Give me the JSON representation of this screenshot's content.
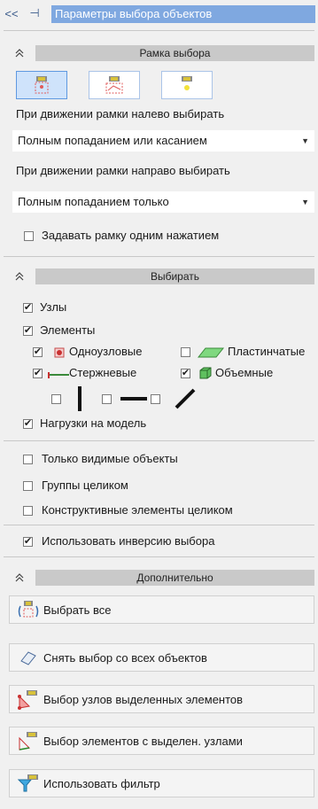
{
  "topbar": {
    "collapse_icon": "<<",
    "pin_icon": "⊣",
    "title": "Параметры выбора объектов"
  },
  "selection_frame": {
    "section_title": "Рамка выбора",
    "left_move_label": "При движении рамки налево выбирать",
    "left_move_value": "Полным попаданием или касанием",
    "right_move_label": "При движении рамки направо выбирать",
    "right_move_value": "Полным попаданием только",
    "single_click_label": "Задавать рамку одним нажатием",
    "single_click_checked": false
  },
  "select": {
    "section_title": "Выбирать",
    "nodes_label": "Узлы",
    "elements_label": "Элементы",
    "single_node_label": "Одноузловые",
    "plate_label": "Пластинчатые",
    "rod_label": "Стержневые",
    "volume_label": "Объемные",
    "loads_label": "Нагрузки на модель",
    "visible_only_label": "Только видимые объекты",
    "groups_label": "Группы целиком",
    "constructive_label": "Конструктивные элементы целиком",
    "inversion_label": "Использовать инверсию выбора"
  },
  "additional": {
    "section_title": "Дополнительно",
    "select_all": "Выбрать все",
    "deselect_all": "Снять выбор со всех объектов",
    "select_nodes_of_elements": "Выбор узлов выделенных элементов",
    "select_elements_with_nodes": "Выбор элементов с выделен. узлами",
    "use_filter": "Использовать фильтр"
  },
  "colors": {
    "title_bar": "#7fa8e0",
    "section_header": "#c9c9c9",
    "selected_button": "#cfe3fb"
  }
}
